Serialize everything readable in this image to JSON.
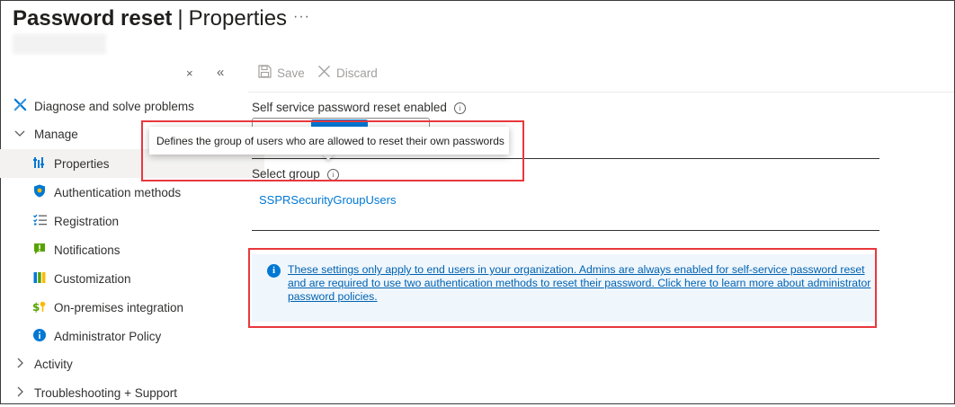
{
  "header": {
    "title_main": "Password reset",
    "title_sep": "|",
    "title_sub": "Properties",
    "more_label": "···"
  },
  "sidebar": {
    "close_glyph": "×",
    "collapse_glyph": "«",
    "items": [
      {
        "label": "Diagnose and solve problems",
        "icon": "wrench-icon"
      },
      {
        "label": "Manage",
        "icon": "chevron-down-icon"
      },
      {
        "label": "Properties",
        "icon": "properties-icon",
        "selected": true
      },
      {
        "label": "Authentication methods",
        "icon": "shield-icon"
      },
      {
        "label": "Registration",
        "icon": "checklist-icon"
      },
      {
        "label": "Notifications",
        "icon": "notification-icon"
      },
      {
        "label": "Customization",
        "icon": "palette-icon"
      },
      {
        "label": "On-premises integration",
        "icon": "dollar-key-icon"
      },
      {
        "label": "Administrator Policy",
        "icon": "info-icon"
      },
      {
        "label": "Activity",
        "icon": "chevron-right-icon"
      },
      {
        "label": "Troubleshooting + Support",
        "icon": "chevron-right-icon"
      }
    ]
  },
  "toolbar": {
    "save_label": "Save",
    "discard_label": "Discard"
  },
  "form": {
    "sspr_label": "Self service password reset enabled",
    "select_group_label": "Select group",
    "group_link": "SSPRSecurityGroupUsers"
  },
  "tooltip": {
    "text": "Defines the group of users who are allowed to reset their own passwords"
  },
  "banner": {
    "text": "These settings only apply to end users in your organization. Admins are always enabled for self-service password reset and are required to use two authentication methods to reset their password. Click here to learn more about administrator password policies."
  },
  "colors": {
    "accent": "#0078d4",
    "annotation": "#e8383d",
    "banner_bg": "#eff6fc"
  }
}
